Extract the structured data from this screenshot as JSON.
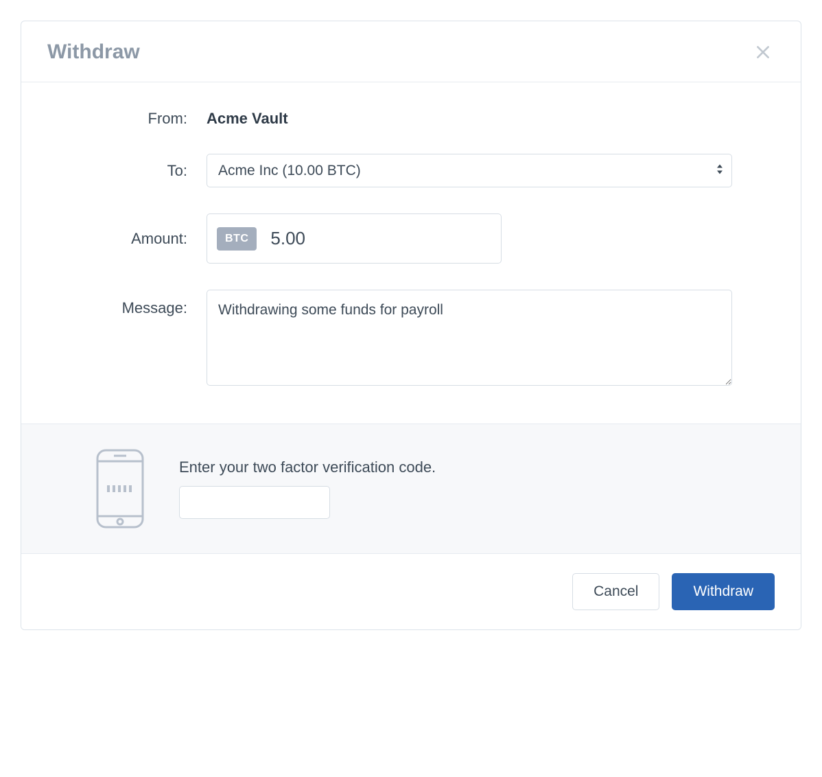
{
  "header": {
    "title": "Withdraw"
  },
  "form": {
    "from_label": "From:",
    "from_value": "Acme Vault",
    "to_label": "To:",
    "to_selected": "Acme Inc (10.00 BTC)",
    "amount_label": "Amount:",
    "amount_currency_badge": "BTC",
    "amount_value": "5.00",
    "message_label": "Message:",
    "message_value": "Withdrawing some funds for payroll"
  },
  "tfa": {
    "prompt": "Enter your two factor verification code.",
    "value": ""
  },
  "footer": {
    "cancel_label": "Cancel",
    "submit_label": "Withdraw"
  }
}
